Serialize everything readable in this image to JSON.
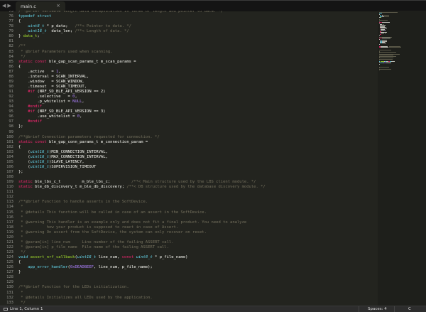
{
  "tabs": [
    {
      "label": "main.c",
      "close": "×"
    }
  ],
  "nav": {
    "back": "◀",
    "forward": "▶"
  },
  "status": {
    "position": "Line 1, Column 1",
    "indentation": "Spaces: 4",
    "syntax": "C"
  },
  "colors": {
    "background": "#23241f",
    "comment": "#75715e",
    "keyword": "#f92672",
    "type": "#66d9ef",
    "function": "#a6e22e",
    "number": "#ae81ff"
  },
  "lines": [
    {
      "n": "75",
      "s": [
        [
          "c",
          "/**@brief Variable length data encapsulation in terms of length and pointer to data. */"
        ]
      ]
    },
    {
      "n": "76",
      "s": [
        [
          "b",
          "typedef struct"
        ]
      ]
    },
    {
      "n": "77",
      "s": [
        [
          "p",
          "{"
        ]
      ]
    },
    {
      "n": "78",
      "s": [
        [
          "p",
          "    "
        ],
        [
          "t",
          "uint8_t"
        ],
        [
          "p",
          " * p_data;   "
        ],
        [
          "c",
          "/**< Pointer to data. */"
        ]
      ]
    },
    {
      "n": "79",
      "s": [
        [
          "p",
          "    "
        ],
        [
          "t",
          "uint16_t"
        ],
        [
          "p",
          "  data_len; "
        ],
        [
          "c",
          "/**< Length of data. */"
        ]
      ]
    },
    {
      "n": "80",
      "s": [
        [
          "p",
          "} "
        ],
        [
          "f",
          "data_t"
        ],
        [
          "p",
          ";"
        ]
      ]
    },
    {
      "n": "81",
      "s": []
    },
    {
      "n": "82",
      "s": [
        [
          "c",
          "/**"
        ]
      ]
    },
    {
      "n": "83",
      "s": [
        [
          "c",
          " * @brief Parameters used when scanning."
        ]
      ]
    },
    {
      "n": "84",
      "s": [
        [
          "c",
          " */"
        ]
      ]
    },
    {
      "n": "85",
      "s": [
        [
          "k",
          "static const"
        ],
        [
          "p",
          " ble_gap_scan_params_t m_scan_params ="
        ]
      ]
    },
    {
      "n": "86",
      "s": [
        [
          "p",
          "{"
        ]
      ]
    },
    {
      "n": "87",
      "s": [
        [
          "p",
          "    .active   = "
        ],
        [
          "n",
          "1"
        ],
        [
          "p",
          ","
        ]
      ]
    },
    {
      "n": "88",
      "s": [
        [
          "p",
          "    .interval = SCAN_INTERVAL,"
        ]
      ]
    },
    {
      "n": "89",
      "s": [
        [
          "p",
          "    .window   = SCAN_WINDOW,"
        ]
      ]
    },
    {
      "n": "90",
      "s": [
        [
          "p",
          "    .timeout  = SCAN_TIMEOUT,"
        ]
      ]
    },
    {
      "n": "91",
      "s": [
        [
          "p",
          "    "
        ],
        [
          "k",
          "#if"
        ],
        [
          "p",
          " (NRF_SD_BLE_API_VERSION == 2)"
        ]
      ]
    },
    {
      "n": "92",
      "s": [
        [
          "p",
          "        .selective   = "
        ],
        [
          "n",
          "0"
        ],
        [
          "p",
          ","
        ]
      ]
    },
    {
      "n": "93",
      "s": [
        [
          "p",
          "        .p_whitelist = "
        ],
        [
          "n",
          "NULL"
        ],
        [
          "p",
          ","
        ]
      ]
    },
    {
      "n": "94",
      "s": [
        [
          "p",
          "    "
        ],
        [
          "k",
          "#endif"
        ]
      ]
    },
    {
      "n": "95",
      "s": [
        [
          "p",
          "    "
        ],
        [
          "k",
          "#if"
        ],
        [
          "p",
          " (NRF_SD_BLE_API_VERSION == 3)"
        ]
      ]
    },
    {
      "n": "96",
      "s": [
        [
          "p",
          "        .use_whitelist = "
        ],
        [
          "n",
          "0"
        ],
        [
          "p",
          ","
        ]
      ]
    },
    {
      "n": "97",
      "s": [
        [
          "p",
          "    "
        ],
        [
          "k",
          "#endif"
        ]
      ]
    },
    {
      "n": "98",
      "s": [
        [
          "p",
          "};"
        ]
      ]
    },
    {
      "n": "99",
      "s": []
    },
    {
      "n": "100",
      "s": [
        [
          "c",
          "/**@brief Connection parameters requested for connection. */"
        ]
      ]
    },
    {
      "n": "101",
      "s": [
        [
          "k",
          "static const"
        ],
        [
          "p",
          " ble_gap_conn_params_t m_connection_param ="
        ]
      ]
    },
    {
      "n": "102",
      "s": [
        [
          "p",
          "{"
        ]
      ]
    },
    {
      "n": "103",
      "s": [
        [
          "p",
          "    ("
        ],
        [
          "t",
          "uint16_t"
        ],
        [
          "p",
          ")MIN_CONNECTION_INTERVAL,"
        ]
      ]
    },
    {
      "n": "104",
      "s": [
        [
          "p",
          "    ("
        ],
        [
          "t",
          "uint16_t"
        ],
        [
          "p",
          ")MAX_CONNECTION_INTERVAL,"
        ]
      ]
    },
    {
      "n": "105",
      "s": [
        [
          "p",
          "    ("
        ],
        [
          "t",
          "uint16_t"
        ],
        [
          "p",
          ")SLAVE_LATENCY,"
        ]
      ]
    },
    {
      "n": "106",
      "s": [
        [
          "p",
          "    ("
        ],
        [
          "t",
          "uint16_t"
        ],
        [
          "p",
          ")SUPERVISION_TIMEOUT"
        ]
      ]
    },
    {
      "n": "107",
      "s": [
        [
          "p",
          "};"
        ]
      ]
    },
    {
      "n": "108",
      "s": []
    },
    {
      "n": "109",
      "s": [
        [
          "k",
          "static"
        ],
        [
          "p",
          " ble_lbs_c_t         m_ble_lbs_c;         "
        ],
        [
          "c",
          "/**< Main structure used by the LBS client module. */"
        ]
      ]
    },
    {
      "n": "110",
      "s": [
        [
          "k",
          "static"
        ],
        [
          "p",
          " ble_db_discovery_t m_ble_db_discovery; "
        ],
        [
          "c",
          "/**< DB structure used by the database discovery module. */"
        ]
      ]
    },
    {
      "n": "111",
      "s": []
    },
    {
      "n": "112",
      "s": []
    },
    {
      "n": "113",
      "s": [
        [
          "c",
          "/**@brief Function to handle asserts in the SoftDevice."
        ]
      ]
    },
    {
      "n": "114",
      "s": [
        [
          "c",
          " *"
        ]
      ]
    },
    {
      "n": "115",
      "s": [
        [
          "c",
          " * @details This function will be called in case of an assert in the SoftDevice."
        ]
      ]
    },
    {
      "n": "116",
      "s": [
        [
          "c",
          " *"
        ]
      ]
    },
    {
      "n": "117",
      "s": [
        [
          "c",
          " * @warning This handler is an example only and does not fit a final product. You need to analyze"
        ]
      ]
    },
    {
      "n": "118",
      "s": [
        [
          "c",
          " *          how your product is supposed to react in case of Assert."
        ]
      ]
    },
    {
      "n": "119",
      "s": [
        [
          "c",
          " * @warning On assert from the SoftDevice, the system can only recover on reset."
        ]
      ]
    },
    {
      "n": "120",
      "s": [
        [
          "c",
          " *"
        ]
      ]
    },
    {
      "n": "121",
      "s": [
        [
          "c",
          " * @param[in] line_num     Line number of the failing ASSERT call."
        ]
      ]
    },
    {
      "n": "122",
      "s": [
        [
          "c",
          " * @param[in] p_file_name  File name of the failing ASSERT call."
        ]
      ]
    },
    {
      "n": "123",
      "s": [
        [
          "c",
          " */"
        ]
      ]
    },
    {
      "n": "124",
      "s": [
        [
          "t",
          "void"
        ],
        [
          "p",
          " "
        ],
        [
          "f",
          "assert_nrf_callback"
        ],
        [
          "p",
          "("
        ],
        [
          "t",
          "uint16_t"
        ],
        [
          "p",
          " line_num, "
        ],
        [
          "k",
          "const"
        ],
        [
          "p",
          " "
        ],
        [
          "t",
          "uint8_t"
        ],
        [
          "p",
          " * p_file_name)"
        ]
      ]
    },
    {
      "n": "125",
      "s": [
        [
          "p",
          "{"
        ]
      ]
    },
    {
      "n": "126",
      "s": [
        [
          "p",
          "    "
        ],
        [
          "b",
          "app_error_handler"
        ],
        [
          "p",
          "("
        ],
        [
          "n",
          "0xDEADBEEF"
        ],
        [
          "p",
          ", line_num, p_file_name);"
        ]
      ]
    },
    {
      "n": "127",
      "s": [
        [
          "p",
          "}"
        ]
      ]
    },
    {
      "n": "128",
      "s": []
    },
    {
      "n": "129",
      "s": []
    },
    {
      "n": "130",
      "s": [
        [
          "c",
          "/**@brief Function for the LEDs initialization."
        ]
      ]
    },
    {
      "n": "131",
      "s": [
        [
          "c",
          " *"
        ]
      ]
    },
    {
      "n": "132",
      "s": [
        [
          "c",
          " * @details Initializes all LEDs used by the application."
        ]
      ]
    },
    {
      "n": "133",
      "s": [
        [
          "c",
          " */"
        ]
      ]
    }
  ]
}
